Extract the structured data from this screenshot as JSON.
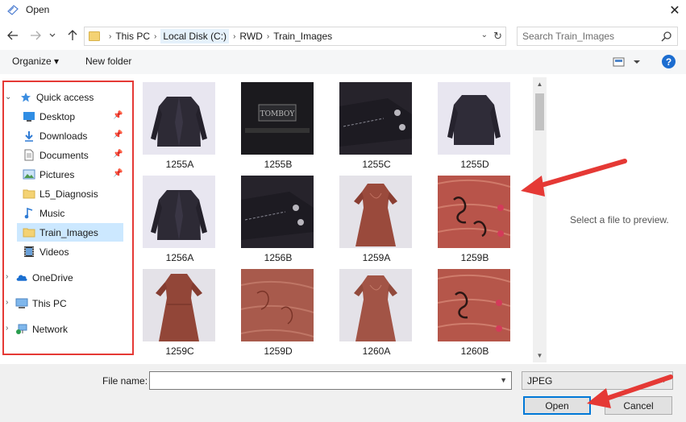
{
  "window": {
    "title": "Open",
    "close_glyph": "✕"
  },
  "nav": {
    "back_icon": "back-arrow-icon",
    "forward_icon": "forward-arrow-icon",
    "recent_icon": "chevron-down-icon",
    "up_icon": "up-arrow-icon",
    "breadcrumb": [
      "This PC",
      "Local Disk (C:)",
      "RWD",
      "Train_Images"
    ],
    "search_placeholder": "Search Train_Images"
  },
  "toolbar": {
    "organize_label": "Organize ▾",
    "new_folder_label": "New folder",
    "help_label": "?"
  },
  "sidebar": {
    "items": [
      {
        "label": "Quick access",
        "icon": "star-icon",
        "pinned": false
      },
      {
        "label": "Desktop",
        "icon": "desktop-icon",
        "pinned": true
      },
      {
        "label": "Downloads",
        "icon": "download-icon",
        "pinned": true
      },
      {
        "label": "Documents",
        "icon": "document-icon",
        "pinned": true
      },
      {
        "label": "Pictures",
        "icon": "pictures-icon",
        "pinned": true
      },
      {
        "label": "L5_Diagnosis",
        "icon": "folder-icon",
        "pinned": false
      },
      {
        "label": "Music",
        "icon": "music-icon",
        "pinned": false
      },
      {
        "label": "Train_Images",
        "icon": "folder-icon",
        "pinned": false,
        "selected": true
      },
      {
        "label": "Videos",
        "icon": "video-icon",
        "pinned": false
      },
      {
        "label": "OneDrive",
        "icon": "cloud-icon",
        "pinned": false
      },
      {
        "label": "This PC",
        "icon": "computer-icon",
        "pinned": false
      },
      {
        "label": "Network",
        "icon": "network-icon",
        "pinned": false
      }
    ]
  },
  "files": [
    {
      "name": "1255A",
      "kind": "jacket"
    },
    {
      "name": "1255B",
      "kind": "label"
    },
    {
      "name": "1255C",
      "kind": "sleeve"
    },
    {
      "name": "1255D",
      "kind": "jacket-back"
    },
    {
      "name": "1256A",
      "kind": "jacket"
    },
    {
      "name": "1256B",
      "kind": "sleeve"
    },
    {
      "name": "1259A",
      "kind": "dress"
    },
    {
      "name": "1259B",
      "kind": "embroidery"
    },
    {
      "name": "1259C",
      "kind": "dress-back"
    },
    {
      "name": "1259D",
      "kind": "fabric"
    },
    {
      "name": "1260A",
      "kind": "dress"
    },
    {
      "name": "1260B",
      "kind": "embroidery"
    }
  ],
  "preview": {
    "text": "Select a file to preview."
  },
  "footer": {
    "filename_label": "File name:",
    "filename_value": "",
    "filetype": "JPEG",
    "open_label": "Open",
    "cancel_label": "Cancel"
  },
  "colors": {
    "highlight": "#e53935",
    "accent": "#0078d7",
    "selected": "#cce8ff"
  }
}
